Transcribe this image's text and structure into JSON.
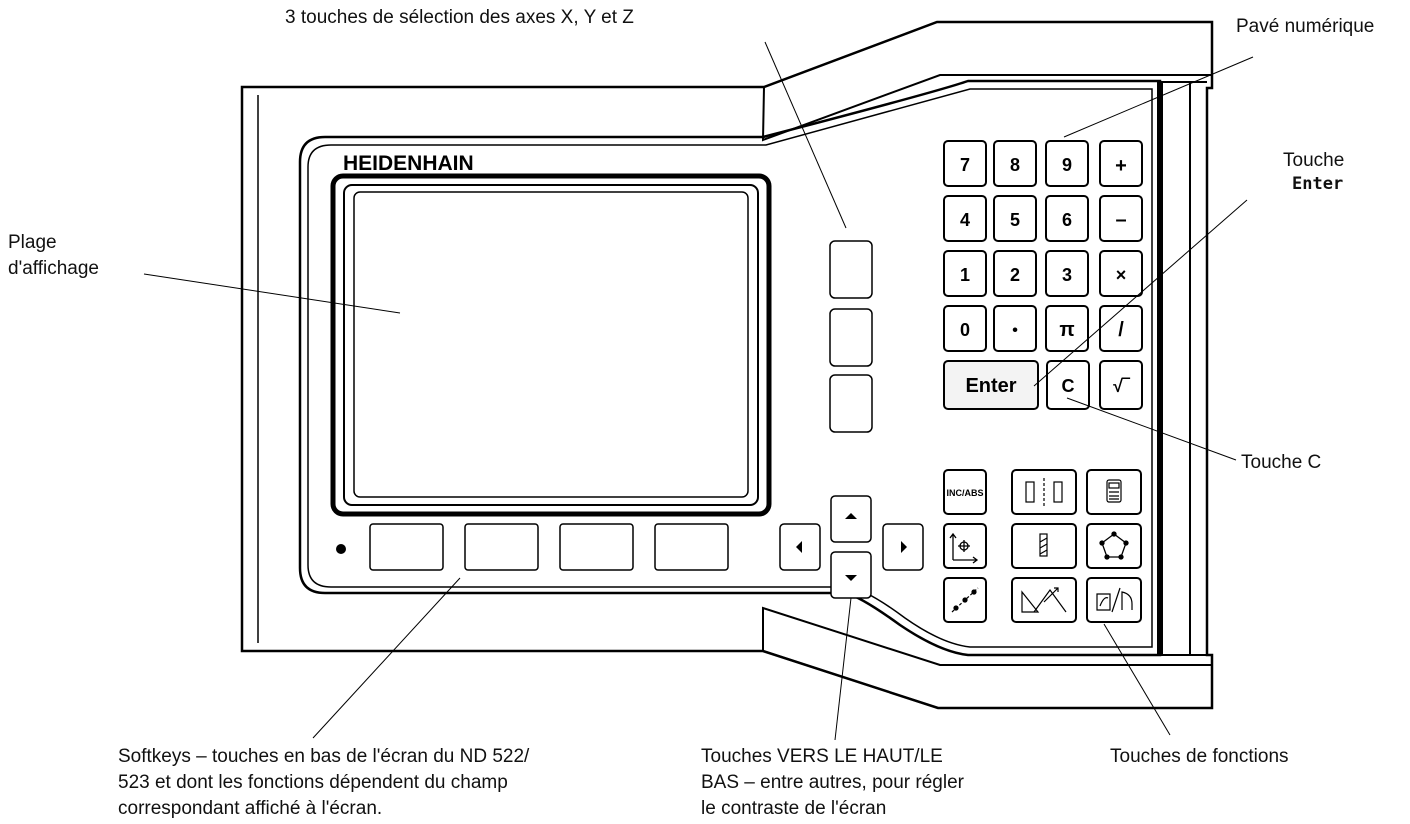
{
  "brand": "HEIDENHAIN",
  "labels": {
    "axis_keys": "3 touches de sélection des axes X, Y et Z",
    "numpad": "Pavé numérique",
    "enter_key_line1": "Touche",
    "enter_key_line2": "Enter",
    "display_line1": "Plage",
    "display_line2": "d'affichage",
    "c_key": "Touche C",
    "softkeys_line1": "Softkeys – touches en bas de l'écran du ND 522/",
    "softkeys_line2": "523 et dont les fonctions dépendent du champ",
    "softkeys_line3": "correspondant affiché à l'écran.",
    "updown_line1": "Touches VERS LE HAUT/LE",
    "updown_line2": "BAS – entre autres, pour régler",
    "updown_line3": "le contraste de l'écran",
    "function_keys": "Touches de fonctions"
  },
  "keypad": {
    "row1": [
      "7",
      "8",
      "9",
      "+"
    ],
    "row2": [
      "4",
      "5",
      "6",
      "–"
    ],
    "row3": [
      "1",
      "2",
      "3",
      "×"
    ],
    "row4": [
      "0",
      "•",
      "π",
      "/"
    ],
    "enter": "Enter",
    "clear": "C",
    "sqrt": "√‾"
  },
  "function_keys": {
    "inc_abs": "INC/ABS"
  },
  "icons": [
    "calculator-icon",
    "datum-icon",
    "tool-icon",
    "bolt-circle-icon",
    "bolt-line-icon",
    "incline-milling-icon",
    "arc-milling-icon",
    "centerline-icon",
    "arrow-up-icon",
    "arrow-down-icon",
    "arrow-left-icon",
    "arrow-right-icon"
  ]
}
